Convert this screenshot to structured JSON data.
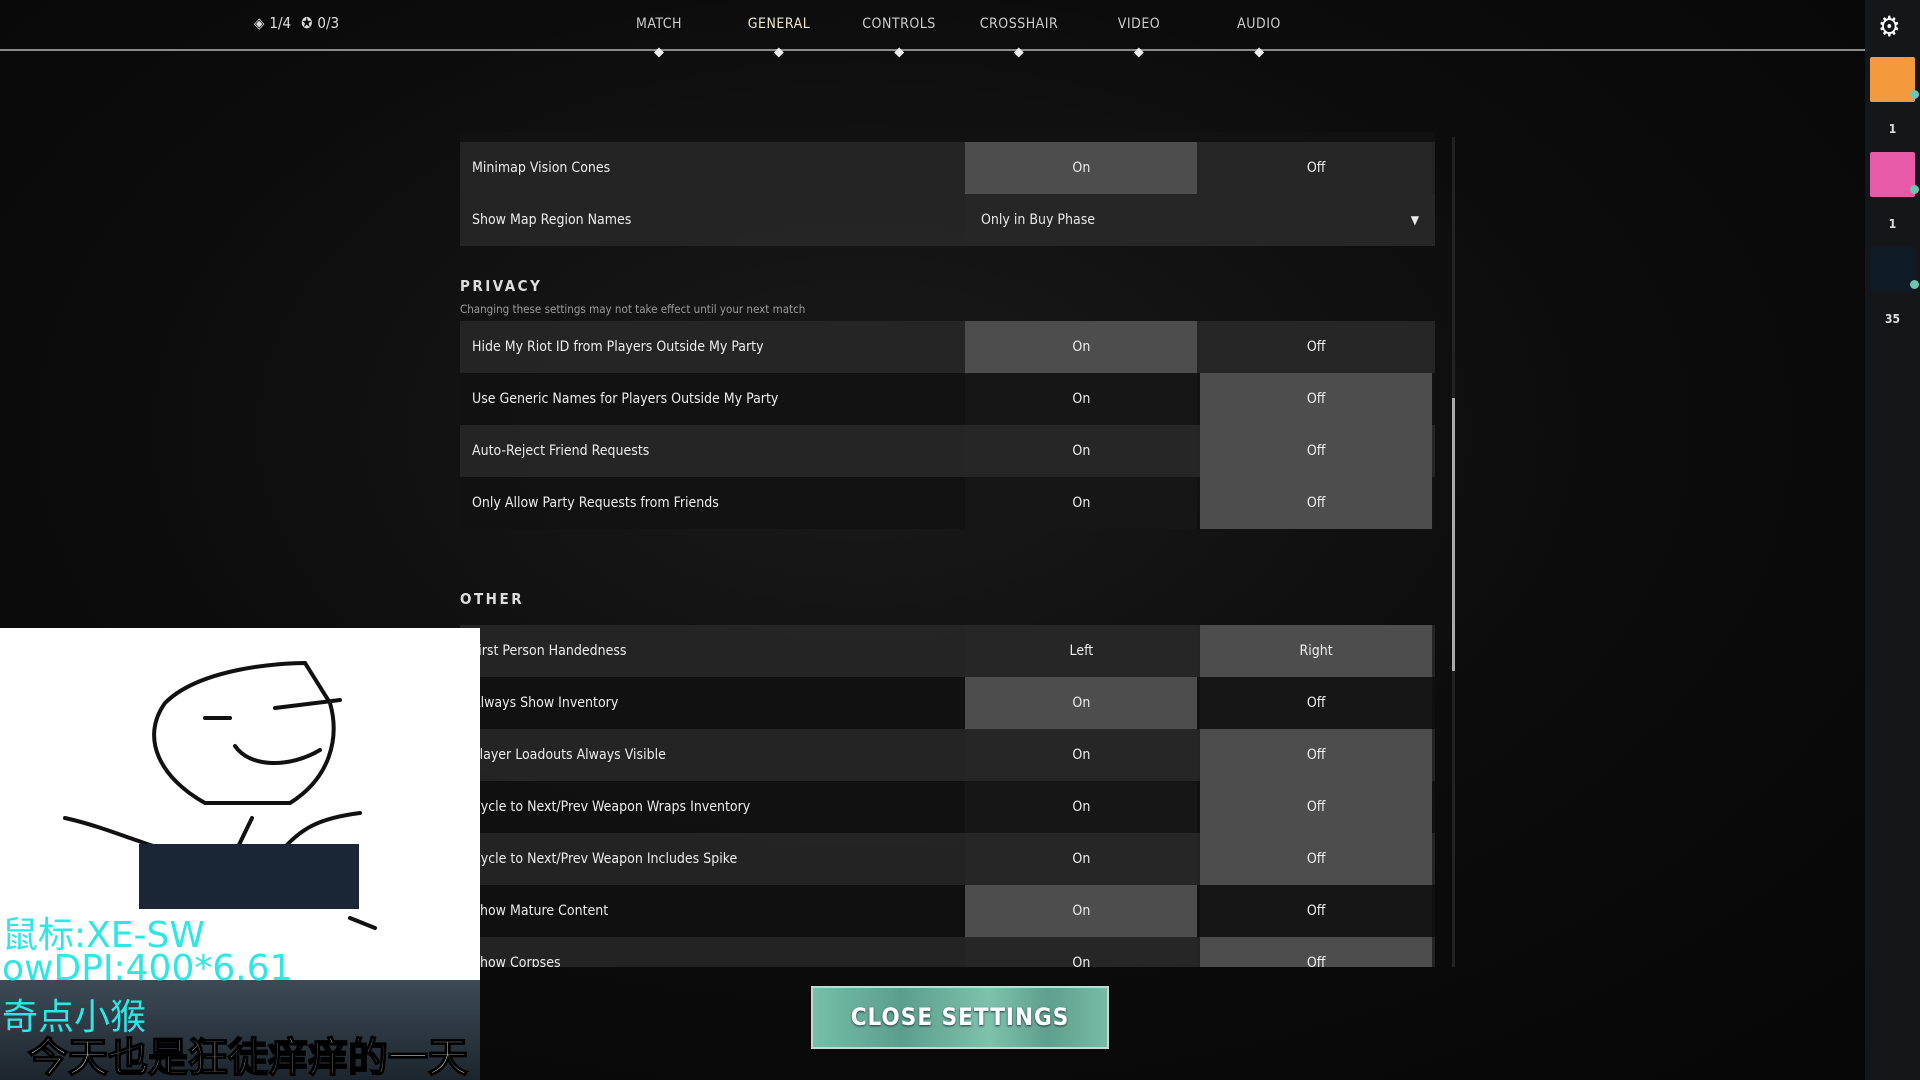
{
  "topbar": {
    "counter1": "1/4",
    "counter2": "0/3",
    "tabs": [
      {
        "label": "MATCH"
      },
      {
        "label": "GENERAL",
        "active": true
      },
      {
        "label": "CONTROLS"
      },
      {
        "label": "CROSSHAIR"
      },
      {
        "label": "VIDEO"
      },
      {
        "label": "AUDIO"
      }
    ]
  },
  "sidebar": {
    "icon": "gear-icon",
    "friends": [
      {
        "count": "1",
        "color": "#f29a3c"
      },
      {
        "count": "1",
        "color": "#e65aa8"
      },
      {
        "count": "35",
        "color": "#0e1a26"
      }
    ]
  },
  "map_rows": [
    {
      "label": "Minimap Vision Cones",
      "options": [
        "On",
        "Off"
      ],
      "selected": 0
    },
    {
      "label": "Show Map Region Names",
      "dropdown": "Only in Buy Phase"
    }
  ],
  "privacy": {
    "title": "PRIVACY",
    "subtitle": "Changing these settings may not take effect until your next match",
    "rows": [
      {
        "label": "Hide My Riot ID from Players Outside My Party",
        "options": [
          "On",
          "Off"
        ],
        "selected": 0
      },
      {
        "label": "Use Generic Names for Players Outside My Party",
        "options": [
          "On",
          "Off"
        ],
        "selected": 1
      },
      {
        "label": "Auto-Reject Friend Requests",
        "options": [
          "On",
          "Off"
        ],
        "selected": 1
      },
      {
        "label": "Only Allow Party Requests from Friends",
        "options": [
          "On",
          "Off"
        ],
        "selected": 1
      }
    ]
  },
  "other": {
    "title": "OTHER",
    "rows": [
      {
        "label": "First Person Handedness",
        "options": [
          "Left",
          "Right"
        ],
        "selected": 1
      },
      {
        "label": "Always Show Inventory",
        "options": [
          "On",
          "Off"
        ],
        "selected": 0
      },
      {
        "label": "Player Loadouts Always Visible",
        "options": [
          "On",
          "Off"
        ],
        "selected": 1
      },
      {
        "label": "Cycle to Next/Prev Weapon Wraps Inventory",
        "options": [
          "On",
          "Off"
        ],
        "selected": 1
      },
      {
        "label": "Cycle to Next/Prev Weapon Includes Spike",
        "options": [
          "On",
          "Off"
        ],
        "selected": 1
      },
      {
        "label": "Show Mature Content",
        "options": [
          "On",
          "Off"
        ],
        "selected": 0
      },
      {
        "label": "Show Corpses",
        "options": [
          "On",
          "Off"
        ],
        "selected": 1
      }
    ]
  },
  "close_label": "CLOSE SETTINGS",
  "overlay": {
    "line1": "鼠标:XE-SW",
    "line2": "owDPI:400*6.61",
    "line3": "奇点小猴",
    "subtitle": "今天也是狂徒痒痒的一天"
  }
}
